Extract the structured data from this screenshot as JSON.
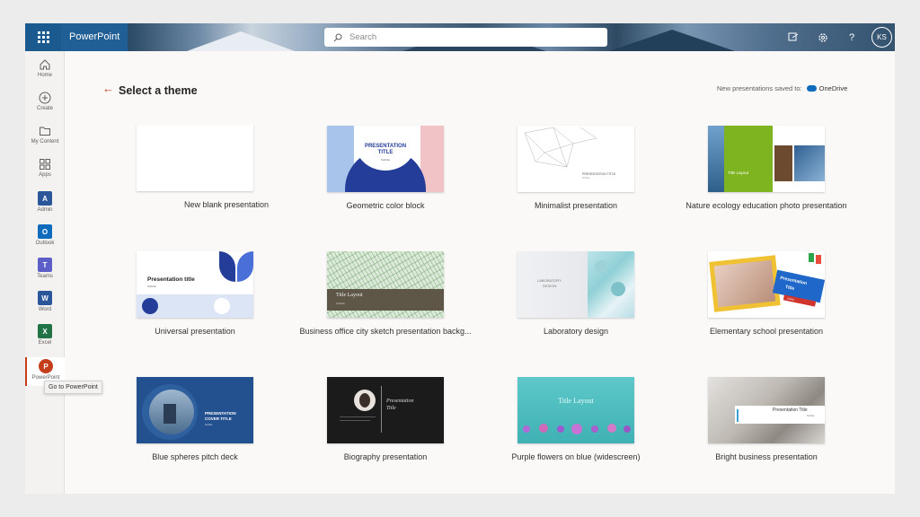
{
  "app": {
    "name": "PowerPoint"
  },
  "search": {
    "placeholder": "Search"
  },
  "header_icons": [
    "whats-new-icon",
    "settings-gear-icon",
    "help-icon"
  ],
  "user": {
    "initials": "KS"
  },
  "rail": [
    {
      "id": "home",
      "label": "Home",
      "icon": "home-icon"
    },
    {
      "id": "create",
      "label": "Create",
      "icon": "plus-circle-icon"
    },
    {
      "id": "my-content",
      "label": "My Content",
      "icon": "folder-icon"
    },
    {
      "id": "apps",
      "label": "Apps",
      "icon": "apps-icon"
    },
    {
      "id": "admin",
      "label": "Admin",
      "icon": "admin-icon",
      "glyph": "A"
    },
    {
      "id": "outlook",
      "label": "Outlook",
      "icon": "outlook-icon",
      "glyph": "O"
    },
    {
      "id": "teams",
      "label": "Teams",
      "icon": "teams-icon",
      "glyph": "T"
    },
    {
      "id": "word",
      "label": "Word",
      "icon": "word-icon",
      "glyph": "W"
    },
    {
      "id": "excel",
      "label": "Excel",
      "icon": "excel-icon",
      "glyph": "X"
    },
    {
      "id": "powerpoint",
      "label": "PowerPoint",
      "icon": "powerpoint-icon",
      "glyph": "P"
    }
  ],
  "tooltip": "Go to PowerPoint",
  "page": {
    "title": "Select a theme",
    "saved_to_label": "New presentations saved to:",
    "saved_to_location": "OneDrive"
  },
  "themes": [
    {
      "label": "New blank presentation"
    },
    {
      "label": "Geometric color block",
      "thumb_text": [
        "PRESENTATION",
        "TITLE",
        "Subtitle"
      ]
    },
    {
      "label": "Minimalist presentation",
      "thumb_text": [
        "PRESENTATION TITLE",
        "Subtitle"
      ]
    },
    {
      "label": "Nature ecology education photo presentation",
      "thumb_text": [
        "Title Layout"
      ]
    },
    {
      "label": "Universal presentation",
      "thumb_text": [
        "Presentation title",
        "Subtitle"
      ]
    },
    {
      "label": "Business office city sketch presentation backg...",
      "thumb_text": [
        "Title Layout",
        "Subtitle"
      ]
    },
    {
      "label": "Laboratory design",
      "thumb_text": [
        "LABORATORY",
        "DESIGN"
      ]
    },
    {
      "label": "Elementary school presentation",
      "thumb_text": [
        "Presentation",
        "Title",
        "Subtitle"
      ]
    },
    {
      "label": "Blue spheres pitch deck",
      "thumb_text": [
        "PRESENTATION",
        "COVER TITLE",
        "Subtitle"
      ]
    },
    {
      "label": "Biography presentation",
      "thumb_text": [
        "Presentation",
        "Title"
      ]
    },
    {
      "label": "Purple flowers on blue (widescreen)",
      "thumb_text": [
        "Title Layout"
      ]
    },
    {
      "label": "Bright business presentation",
      "thumb_text": [
        "Presentation Title",
        "Subtitle"
      ]
    }
  ],
  "colors": {
    "accent": "#c43e1c",
    "brand_blue": "#1f5f95",
    "admin": "#2b579a",
    "outlook": "#0f6cbd",
    "teams": "#5b5fc7",
    "word": "#2b579a",
    "excel": "#217346",
    "powerpoint": "#c43e1c"
  }
}
